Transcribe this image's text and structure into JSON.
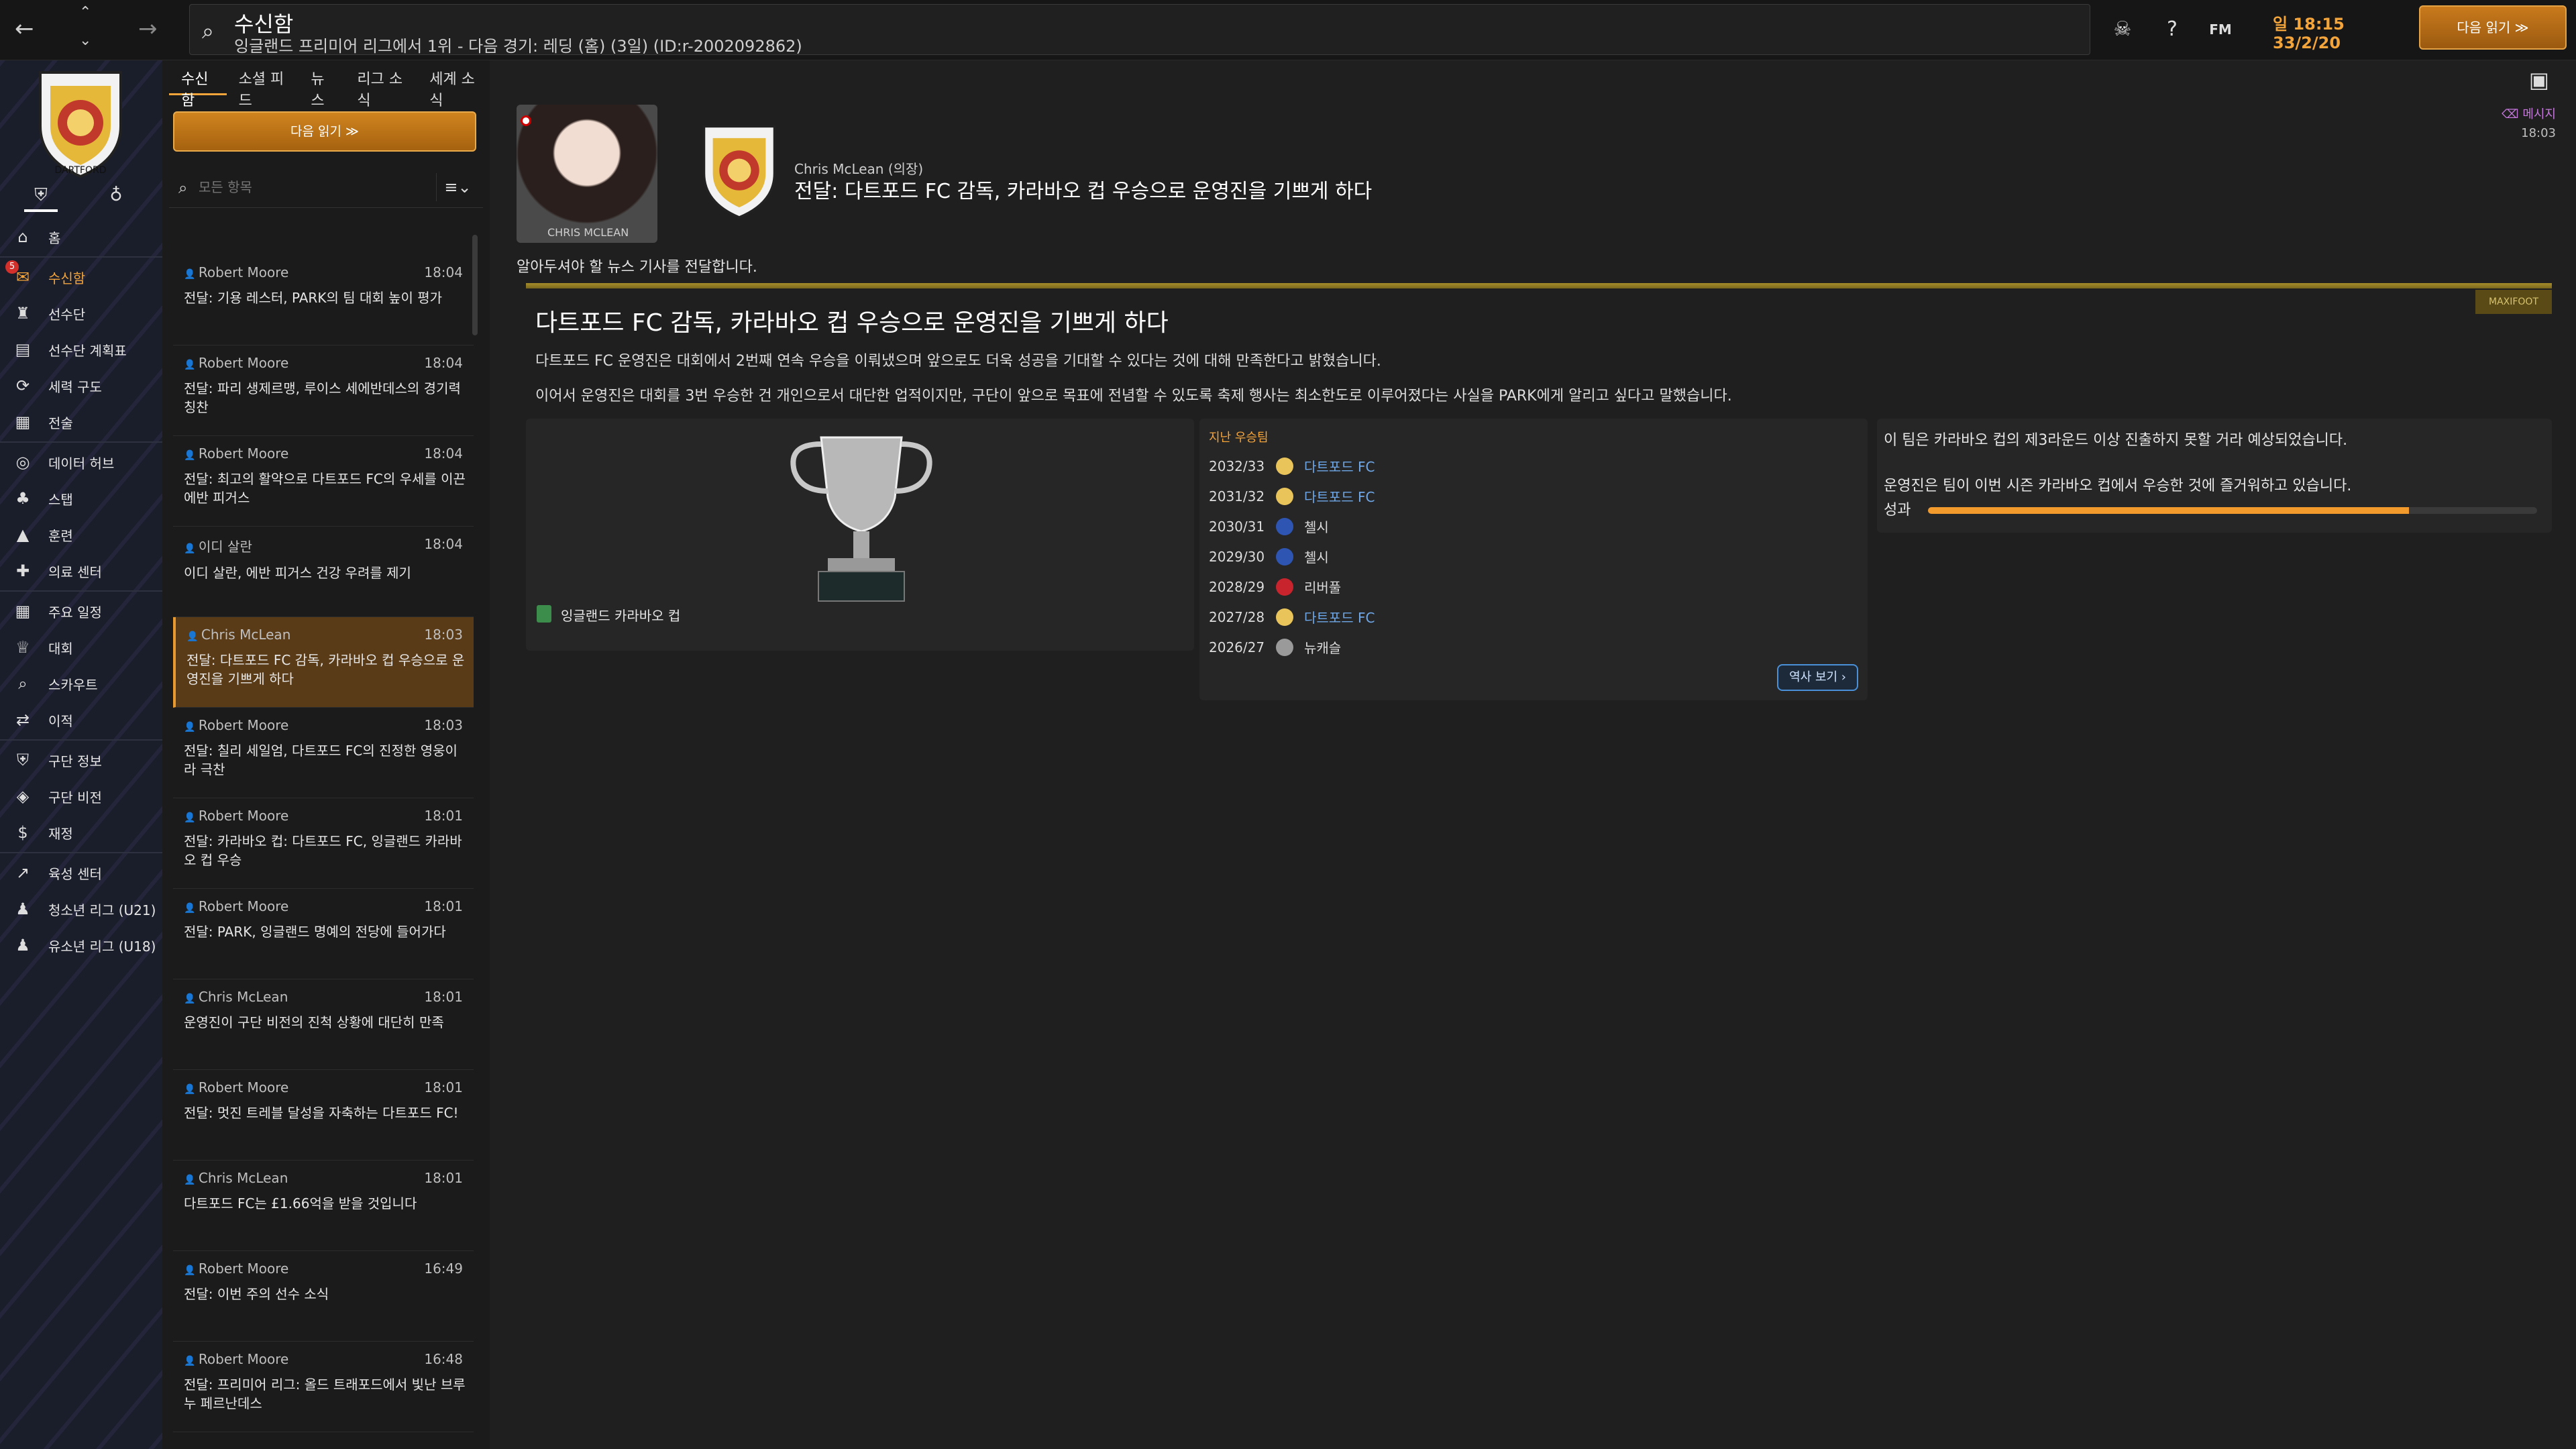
{
  "topbar": {
    "title": "수신함",
    "subtitle": "잉글랜드 프리미어 리그에서 1위 - 다음 경기: 레딩 (홈) (3일) (ID:r-2002092862)",
    "time": "일 18:15",
    "date": "33/2/20",
    "continue_label": "다음 읽기 ≫",
    "fm_label": "FM"
  },
  "sidebar": {
    "items": [
      {
        "label": "홈",
        "icon": "home-icon"
      },
      {
        "label": "수신함",
        "icon": "inbox-icon",
        "active": true,
        "badge": "5"
      },
      {
        "label": "선수단",
        "icon": "squad-icon"
      },
      {
        "label": "선수단 계획표",
        "icon": "planner-icon"
      },
      {
        "label": "세력 구도",
        "icon": "dynamics-icon"
      },
      {
        "label": "전술",
        "icon": "tactics-icon"
      },
      {
        "label": "데이터 허브",
        "icon": "data-hub-icon"
      },
      {
        "label": "스탭",
        "icon": "staff-icon"
      },
      {
        "label": "훈련",
        "icon": "training-icon"
      },
      {
        "label": "의료 센터",
        "icon": "medical-icon"
      },
      {
        "label": "주요 일정",
        "icon": "schedule-icon"
      },
      {
        "label": "대회",
        "icon": "trophy-icon"
      },
      {
        "label": "스카우트",
        "icon": "scouting-icon"
      },
      {
        "label": "이적",
        "icon": "transfers-icon"
      },
      {
        "label": "구단 정보",
        "icon": "club-info-icon"
      },
      {
        "label": "구단 비전",
        "icon": "club-vision-icon"
      },
      {
        "label": "재정",
        "icon": "finances-icon"
      },
      {
        "label": "육성 센터",
        "icon": "development-icon"
      },
      {
        "label": "청소년 리그 (U21)",
        "icon": "u21-icon"
      },
      {
        "label": "유소년 리그 (U18)",
        "icon": "u18-icon"
      }
    ]
  },
  "inbox": {
    "tabs": [
      "수신함",
      "소셜 피드",
      "뉴스",
      "리그 소식",
      "세계 소식"
    ],
    "continue_label": "다음 읽기 ≫",
    "filter_placeholder": "모든 항목",
    "messages": [
      {
        "from": "Robert Moore",
        "time": "18:04",
        "subject": "전달: 기용 레스터, PARK의 팀 대회 높이 평가"
      },
      {
        "from": "Robert Moore",
        "time": "18:04",
        "subject": "전달: 파리 생제르맹, 루이스 세에반데스의 경기력 칭찬"
      },
      {
        "from": "Robert Moore",
        "time": "18:04",
        "subject": "전달: 최고의 활약으로 다트포드 FC의 우세를 이끈 에반 피거스"
      },
      {
        "from": "이디 살란",
        "time": "18:04",
        "subject": "이디 살란, 에반 피거스 건강 우려를 제기"
      },
      {
        "from": "Chris McLean",
        "time": "18:03",
        "subject": "전달: 다트포드 FC 감독, 카라바오 컵 우승으로 운영진을 기쁘게 하다",
        "selected": true
      },
      {
        "from": "Robert Moore",
        "time": "18:03",
        "subject": "전달: 칠리 세일엄, 다트포드 FC의 진정한 영웅이라 극찬"
      },
      {
        "from": "Robert Moore",
        "time": "18:01",
        "subject": "전달: 카라바오 컵: 다트포드 FC, 잉글랜드 카라바오 컵 우승"
      },
      {
        "from": "Robert Moore",
        "time": "18:01",
        "subject": "전달: PARK, 잉글랜드 명예의 전당에 들어가다"
      },
      {
        "from": "Chris McLean",
        "time": "18:01",
        "subject": "운영진이 구단 비전의 진척 상황에 대단히 만족"
      },
      {
        "from": "Robert Moore",
        "time": "18:01",
        "subject": "전달: 멋진 트레블 달성을 자축하는 다트포드 FC!"
      },
      {
        "from": "Chris McLean",
        "time": "18:01",
        "subject": "다트포드 FC는 £1.66억을 받을 것입니다"
      },
      {
        "from": "Robert Moore",
        "time": "16:49",
        "subject": "전달: 이번 주의 선수 소식"
      },
      {
        "from": "Robert Moore",
        "time": "16:48",
        "subject": "전달: 프리미어 리그: 올드 트래포드에서 빛난 브루누 페르난데스"
      }
    ]
  },
  "message": {
    "sender": "Chris McLean (의장)",
    "photo_caption": "CHRIS MCLEAN",
    "subject": "전달: 다트포드 FC 감독, 카라바오 컵 우승으로 운영진을 기쁘게 하다",
    "reply_link": "⌫ 메시지",
    "time": "18:03",
    "intro": "알아두셔야 할 뉴스 기사를 전달합니다.",
    "source": "MAXIFOOT",
    "headline": "다트포드 FC 감독, 카라바오 컵 우승으로 운영진을 기쁘게 하다",
    "para1": "다트포드 FC 운영진은 대회에서 2번째 연속 우승을 이뤄냈으며 앞으로도 더욱 성공을 기대할 수 있다는 것에 대해 만족한다고 밝혔습니다.",
    "para2": "이어서 운영진은 대회를 3번 우승한 건 개인으로서 대단한 업적이지만, 구단이 앞으로 목표에 전념할 수 있도록 축제 행사는 최소한도로 이루어졌다는 사실을 PARK에게 알리고 싶다고 말했습니다.",
    "cup_name": "잉글랜드 카라바오 컵",
    "winners_title": "지난 우승팀",
    "winners": [
      {
        "season": "2032/33",
        "club": "다트포드 FC",
        "link": true,
        "crest_color": "#e8c45a"
      },
      {
        "season": "2031/32",
        "club": "다트포드 FC",
        "link": true,
        "crest_color": "#e8c45a"
      },
      {
        "season": "2030/31",
        "club": "첼시",
        "link": false,
        "crest_color": "#2f55b3"
      },
      {
        "season": "2029/30",
        "club": "첼시",
        "link": false,
        "crest_color": "#2f55b3"
      },
      {
        "season": "2028/29",
        "club": "리버풀",
        "link": false,
        "crest_color": "#c8242e"
      },
      {
        "season": "2027/28",
        "club": "다트포드 FC",
        "link": true,
        "crest_color": "#e8c45a"
      },
      {
        "season": "2026/27",
        "club": "뉴캐슬",
        "link": false,
        "crest_color": "#9a9a9a"
      }
    ],
    "history_button": "역사 보기 ›",
    "expect_line": "이 팀은 카라바오 컵의 제3라운드 이상 진출하지 못할 거라 예상되었습니다.",
    "board_line": "운영진은 팀이 이번 시즌 카라바오 컵에서 우승한 것에 즐거워하고 있습니다.",
    "performance_label": "성과",
    "performance_value": 0.79
  }
}
